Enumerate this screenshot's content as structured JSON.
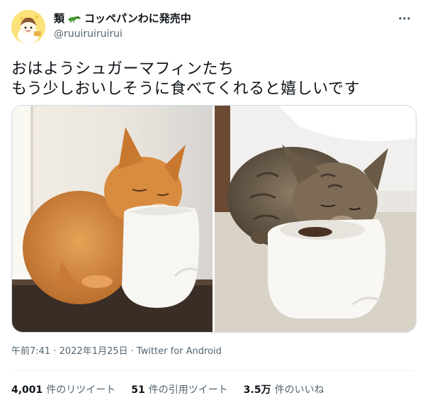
{
  "author": {
    "display_name": "類コッペパンわに発売中",
    "handle": "@ruuiruiruirui"
  },
  "tweet": {
    "lines": [
      "おはようシュガーマフィンたち",
      "もう少しおいしそうに食べてくれると嬉しいです"
    ]
  },
  "meta": {
    "time": "午前7:41",
    "sep1": " · ",
    "date": "2022年1月25日",
    "sep2": " · ",
    "source": "Twitter for Android"
  },
  "stats": {
    "retweets": {
      "count": "4,001",
      "label": "件のリツイート"
    },
    "quotes": {
      "count": "51",
      "label": "件の引用ツイート"
    },
    "likes": {
      "count": "3.5万",
      "label": "件のいいね"
    }
  },
  "icons": [
    "avatar",
    "crocodile-icon",
    "more-icon"
  ],
  "colors": {
    "text": "#0f1419",
    "secondary": "#536471",
    "border": "#cfd9de",
    "divider": "#eff3f4"
  }
}
